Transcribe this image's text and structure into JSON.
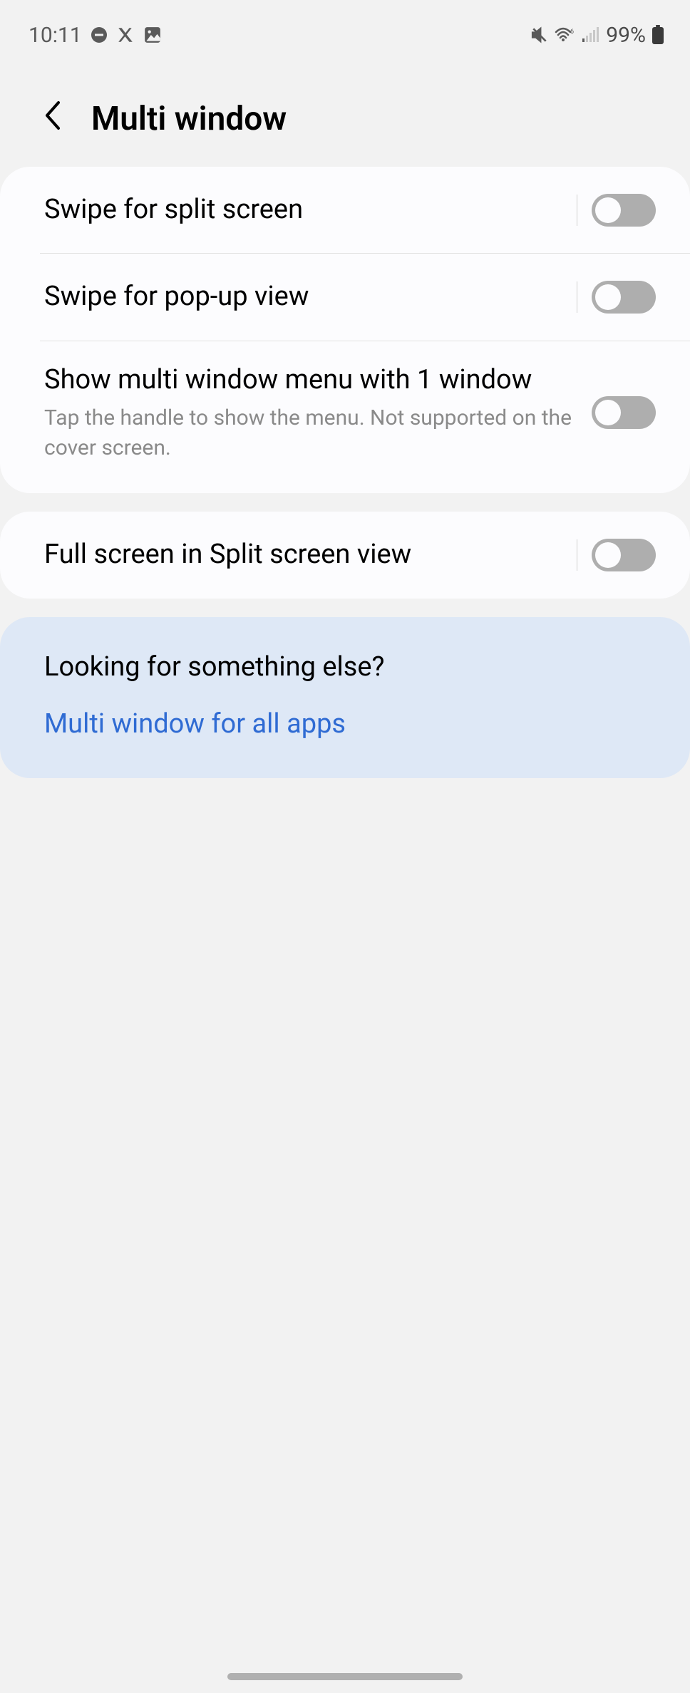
{
  "status_bar": {
    "time": "10:11",
    "battery": "99%"
  },
  "header": {
    "title": "Multi window"
  },
  "settings": {
    "swipe_split": {
      "title": "Swipe for split screen",
      "enabled": false
    },
    "swipe_popup": {
      "title": "Swipe for pop-up view",
      "enabled": false
    },
    "show_menu": {
      "title": "Show multi window menu with 1 window",
      "subtitle": "Tap the handle to show the menu. Not supported on the cover screen.",
      "enabled": false
    },
    "fullscreen_split": {
      "title": "Full screen in Split screen view",
      "enabled": false
    }
  },
  "suggestion": {
    "title": "Looking for something else?",
    "link": "Multi window for all apps"
  }
}
